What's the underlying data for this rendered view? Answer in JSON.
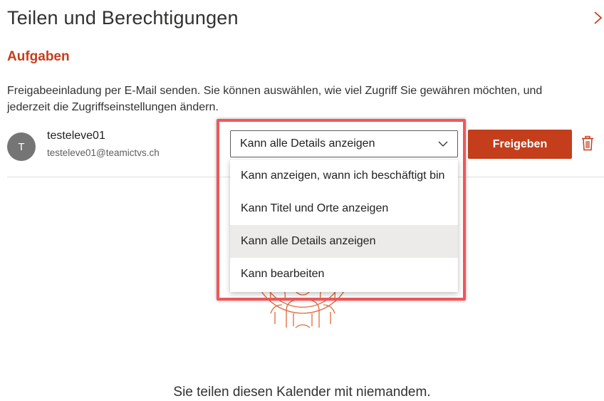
{
  "header": {
    "title": "Teilen und Berechtigungen"
  },
  "section": {
    "heading": "Aufgaben",
    "description": "Freigabeeinladung per E-Mail senden. Sie können auswählen, wie viel Zugriff Sie gewähren möchten, und jederzeit die Zugriffseinstellungen ändern."
  },
  "share_row": {
    "avatar_initial": "T",
    "user_name": "testeleve01",
    "user_email": "testeleve01@teamictvs.ch",
    "permission_selected": "Kann alle Details anzeigen",
    "share_button_label": "Freigeben"
  },
  "dropdown": {
    "options": [
      "Kann anzeigen, wann ich beschäftigt bin",
      "Kann Titel und Orte anzeigen",
      "Kann alle Details anzeigen",
      "Kann bearbeiten"
    ],
    "selected_index": 2
  },
  "empty_state": {
    "message": "Sie teilen diesen Kalender mit niemandem."
  },
  "colors": {
    "accent": "#c43e1c",
    "highlight": "#f0575a",
    "selected_option_bg": "#edebe9"
  },
  "icons": {
    "collapse": "chevron-right-icon",
    "select": "chevron-down-icon",
    "delete": "trash-icon",
    "empty_state": "people-illustration"
  }
}
